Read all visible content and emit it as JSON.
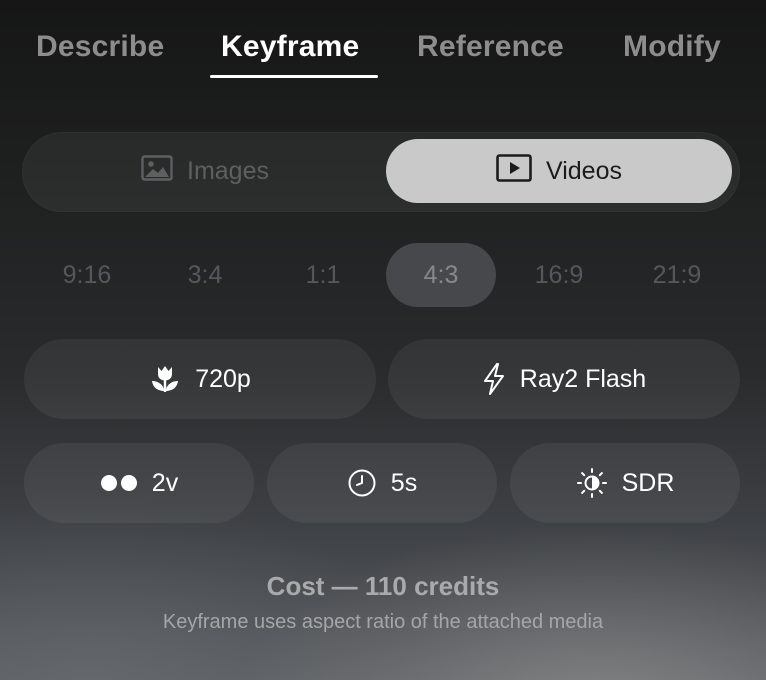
{
  "tabs": [
    {
      "label": "Describe"
    },
    {
      "label": "Keyframe"
    },
    {
      "label": "Reference"
    },
    {
      "label": "Modify"
    }
  ],
  "active_tab": "Keyframe",
  "media_toggle": {
    "images_label": "Images",
    "videos_label": "Videos",
    "selected": "Videos"
  },
  "aspect_ratios": {
    "options": [
      "9:16",
      "3:4",
      "1:1",
      "4:3",
      "16:9",
      "21:9"
    ],
    "selected": "4:3"
  },
  "settings": {
    "resolution": {
      "label": "720p",
      "icon": "tulip-icon"
    },
    "model": {
      "label": "Ray2 Flash",
      "icon": "lightning-icon"
    },
    "variations": {
      "label": "2v",
      "icon": "two-dots-icon"
    },
    "duration": {
      "label": "5s",
      "icon": "clock-icon"
    },
    "dynamic_range": {
      "label": "SDR",
      "icon": "sun-icon"
    }
  },
  "footer": {
    "cost": "Cost — 110 credits",
    "note": "Keyframe uses aspect ratio of the attached media"
  }
}
